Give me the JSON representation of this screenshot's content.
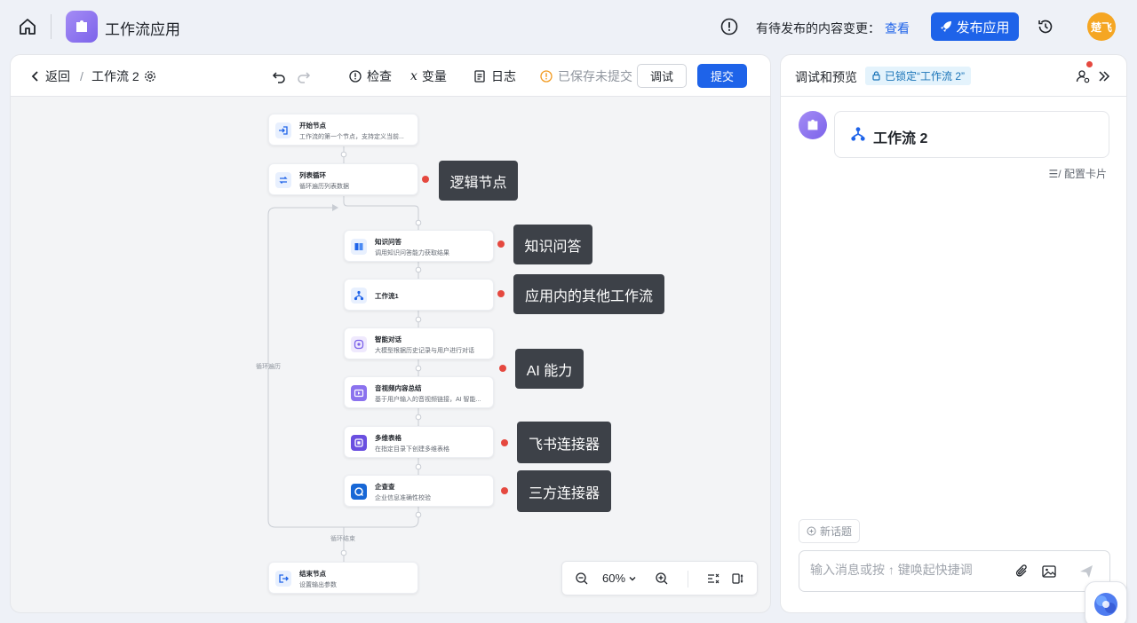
{
  "app": {
    "title": "工作流应用",
    "pending_text": "有待发布的内容变更：",
    "pending_link": "查看",
    "publish_label": "发布应用",
    "avatar_text": "楚飞"
  },
  "editor": {
    "back_label": "返回",
    "breadcrumb_sep": "/",
    "workflow_name": "工作流 2",
    "check_label": "检查",
    "variables_label": "变量",
    "log_label": "日志",
    "save_status": "已保存未提交",
    "debug_label": "调试",
    "submit_label": "提交"
  },
  "nodes": [
    {
      "title": "开始节点",
      "desc": "工作流的第一个节点，支持定义当前..."
    },
    {
      "title": "列表循环",
      "desc": "循环遍历列表数据"
    },
    {
      "title": "知识问答",
      "desc": "调用知识问答能力获取结果"
    },
    {
      "title": "工作流1",
      "desc": ""
    },
    {
      "title": "智能对话",
      "desc": "大模型根据历史记录与用户进行对话"
    },
    {
      "title": "音视频内容总结",
      "desc": "基于用户输入的音视频链接，AI 智能..."
    },
    {
      "title": "多维表格",
      "desc": "在指定目录下创建多维表格"
    },
    {
      "title": "企查查",
      "desc": "企业信息准确性校验"
    },
    {
      "title": "结束节点",
      "desc": "设置输出参数"
    }
  ],
  "loop": {
    "side_label": "循环遍历",
    "end_label": "循环结束"
  },
  "callouts": [
    "逻辑节点",
    "知识问答",
    "应用内的其他工作流",
    "AI 能力",
    "飞书连接器",
    "三方连接器"
  ],
  "zoom": {
    "value": "60%"
  },
  "preview": {
    "title": "调试和预览",
    "lock_badge": "已锁定“工作流 2”",
    "card_title": "工作流 2",
    "config_card": "配置卡片",
    "new_topic": "新话题",
    "input_placeholder": "输入消息或按 ↑ 键唤起快捷调"
  },
  "colors": {
    "primary": "#1e63e9",
    "callout_bg": "#3d4148",
    "dot": "#e5483f",
    "brand_purple": "#8b72ee"
  }
}
